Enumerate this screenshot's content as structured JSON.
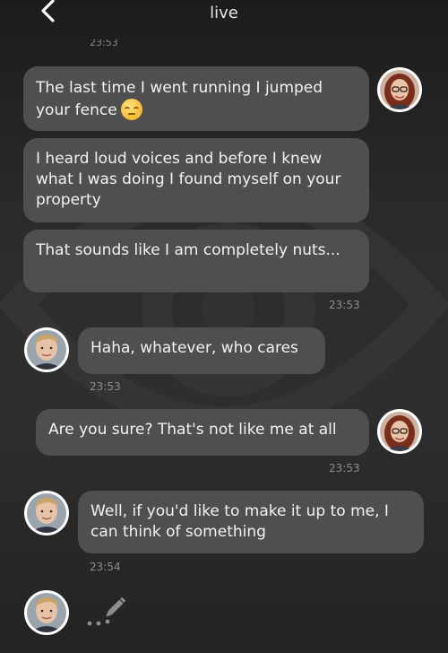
{
  "header": {
    "title": "live",
    "back_icon": "chevron-left-icon"
  },
  "messages": [
    {
      "sender": "woman",
      "text": "The last time I went running I jumped your fence",
      "emoji": "relieved-face-emoji"
    },
    {
      "sender": "woman",
      "text": "I heard loud voices and before I knew what I was doing I found myself on your property"
    },
    {
      "sender": "woman",
      "text": "That sounds like I am completely nuts...",
      "time": "23:53"
    },
    {
      "sender": "man",
      "text": "Haha, whatever, who cares",
      "time": "23:53"
    },
    {
      "sender": "woman",
      "text": "Are you sure? That's not like me at all",
      "time": "23:53"
    },
    {
      "sender": "man",
      "text": "Well, if you'd like to make it up to me, I can think of something",
      "time": "23:54"
    }
  ],
  "typing_indicator": {
    "icon": "pencil-icon",
    "dots": 3
  },
  "colors": {
    "bubble": "#4f4f4f",
    "background": "#2a2a2a",
    "time_text": "#8c8c8c"
  }
}
